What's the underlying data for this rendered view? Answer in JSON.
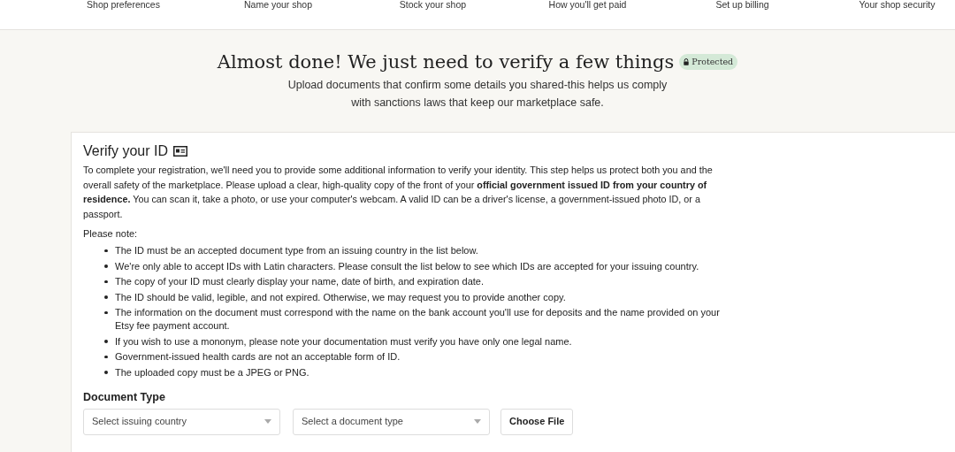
{
  "steps": [
    "Shop preferences",
    "Name your shop",
    "Stock your shop",
    "How you'll get paid",
    "Set up billing",
    "Your shop security"
  ],
  "header": {
    "title": "Almost done! We just need to verify a few things",
    "badge": "Protected",
    "subtitle_lines": [
      "Upload documents that confirm some details you shared-this helps us comply",
      "with sanctions laws that keep our marketplace safe."
    ]
  },
  "card": {
    "title": "Verify your ID",
    "intro": "To complete your registration, we'll need you to provide some additional information to verify your identity. This step helps us protect both you and the overall safety of the marketplace. Please upload a clear, high-quality copy of the front of your **official government issued ID from your country of residence.** You can scan it, take a photo, or use your computer's webcam. A valid ID can be a driver's license, a government-issued photo ID, or a passport.",
    "note_label": "Please note:",
    "notes": [
      "The ID must be an accepted document type from an issuing country in the list below.",
      "We're only able to accept IDs with Latin characters. Please consult the list below to see which IDs are accepted for your issuing country.",
      "The copy of your ID must clearly display your name, date of birth, and expiration date.",
      "The ID should be valid, legible, and not expired. Otherwise, we may request you to provide another copy.",
      "The information on the document must correspond with the name on the bank account you'll use for deposits and the name provided on your Etsy fee payment account.",
      "If you wish to use a mononym, please note your documentation must verify you have only one legal name.",
      "Government-issued health cards are not an acceptable form of ID.",
      "The uploaded copy must be a JPEG or PNG."
    ],
    "document_type": {
      "label": "Document Type",
      "country_select": {
        "placeholder": "Select issuing country"
      },
      "type_select": {
        "placeholder": "Select a document type"
      },
      "file_button": "Choose File"
    }
  }
}
